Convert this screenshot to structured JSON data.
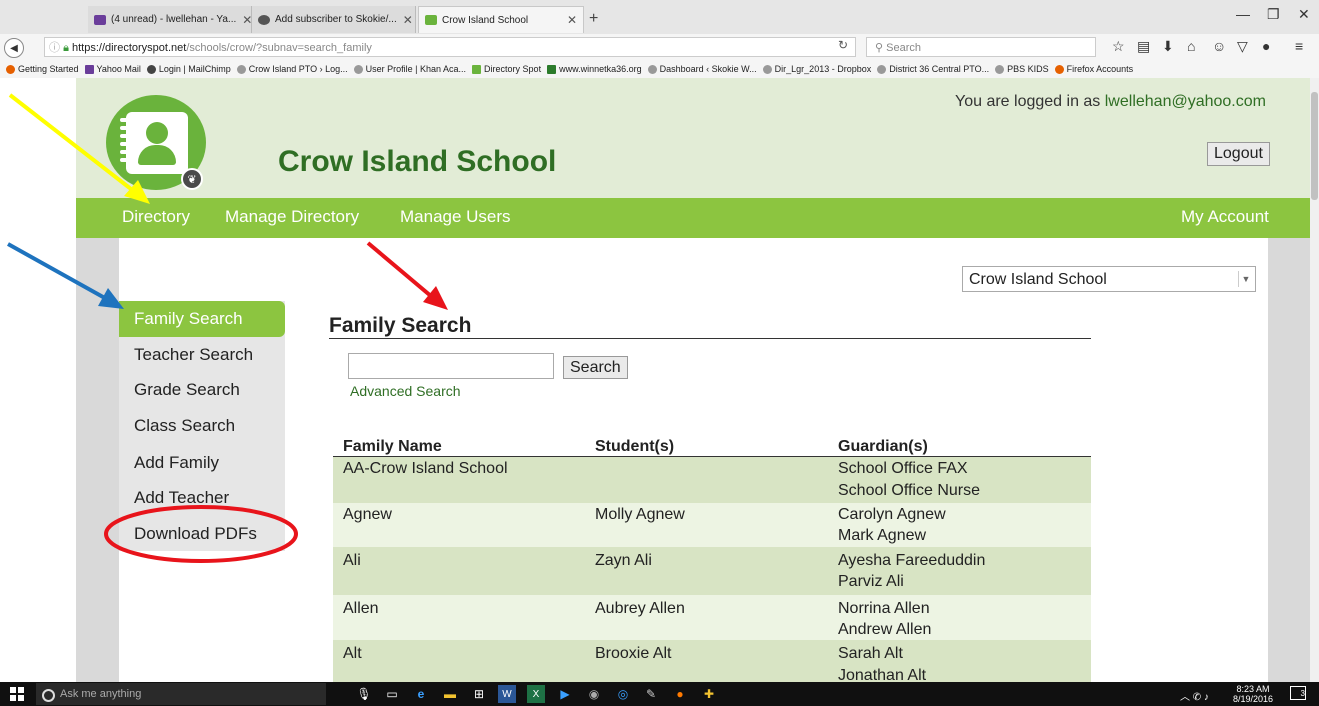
{
  "browser": {
    "tabs": [
      {
        "label": "(4 unread) - lwellehan - Ya...",
        "icon": "mail-icon",
        "active": false
      },
      {
        "label": "Add subscriber to Skokie/...",
        "icon": "mailchimp-icon",
        "active": false
      },
      {
        "label": "Crow Island School",
        "icon": "directory-spot-icon",
        "active": true
      }
    ],
    "url_domain": "https://directoryspot.net",
    "url_path": "/schools/crow/?subnav=search_family",
    "search_placeholder": "Search",
    "bookmarks": [
      "Getting Started",
      "Yahoo Mail",
      "Login | MailChimp",
      "Crow Island PTO › Log...",
      "User Profile | Khan Aca...",
      "Directory Spot",
      "www.winnetka36.org",
      "Dashboard ‹ Skokie W...",
      "Dir_Lgr_2013 - Dropbox",
      "District 36 Central PTO...",
      "PBS KIDS",
      "Firefox Accounts"
    ]
  },
  "header": {
    "school_name": "Crow Island School",
    "logged_in_prefix": "You are logged in as ",
    "user_email": "lwellehan@yahoo.com",
    "logout_label": "Logout"
  },
  "nav": {
    "items": [
      "Directory",
      "Manage Directory",
      "Manage Users"
    ],
    "account": "My Account"
  },
  "school_select": {
    "selected": "Crow Island School"
  },
  "sidebar": {
    "items": [
      "Family Search",
      "Teacher Search",
      "Grade Search",
      "Class Search",
      "Add Family",
      "Add Teacher",
      "Download PDFs"
    ],
    "active_index": 0
  },
  "main": {
    "title": "Family Search",
    "search_button": "Search",
    "advanced_search": "Advanced Search",
    "columns": [
      "Family Name",
      "Student(s)",
      "Guardian(s)"
    ],
    "rows": [
      {
        "family": "AA-Crow Island School",
        "students": "",
        "guardians": [
          "School Office FAX",
          "School Office Nurse"
        ]
      },
      {
        "family": "Agnew",
        "students": "Molly Agnew",
        "guardians": [
          "Carolyn Agnew",
          "Mark Agnew"
        ]
      },
      {
        "family": "Ali",
        "students": "Zayn Ali",
        "guardians": [
          "Ayesha Fareeduddin",
          "Parviz Ali"
        ]
      },
      {
        "family": "Allen",
        "students": "Aubrey Allen",
        "guardians": [
          "Norrina Allen",
          "Andrew Allen"
        ]
      },
      {
        "family": "Alt",
        "students": "Brooxie Alt",
        "guardians": [
          "Sarah Alt",
          "Jonathan Alt"
        ]
      }
    ]
  },
  "colors": {
    "brand_green": "#8cc540",
    "dark_green": "#2f6e24",
    "annotation_yellow": "#ffff00",
    "annotation_blue": "#1e73be",
    "annotation_red": "#e8141b"
  },
  "taskbar": {
    "search_placeholder": "Ask me anything",
    "time": "8:23 AM",
    "date": "8/19/2016",
    "notification_count": "3"
  }
}
